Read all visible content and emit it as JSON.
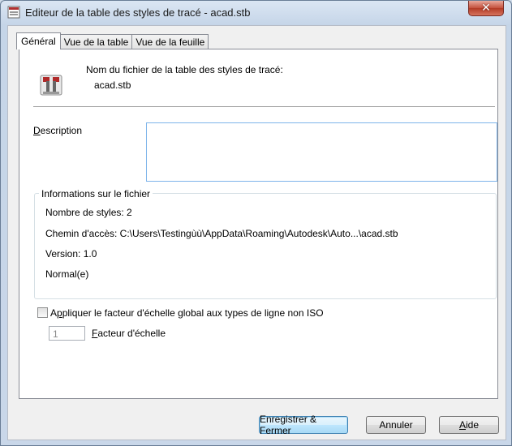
{
  "window": {
    "title": "Editeur de la table des styles de tracé - acad.stb",
    "close_glyph": "✕"
  },
  "tabs": [
    "Général",
    "Vue de la table",
    "Vue de la feuille"
  ],
  "file": {
    "label": "Nom du fichier de la table des styles de tracé:",
    "name": "acad.stb",
    "icon": "plot-style-table-icon"
  },
  "description": {
    "label_mnemonic": "D",
    "label_rest": "escription",
    "value": ""
  },
  "file_info": {
    "title": "Informations sur le fichier",
    "styles_count": "Nombre de styles: 2",
    "path": "Chemin d'accès: C:\\Users\\Testingùù\\AppData\\Roaming\\Autodesk\\Auto...\\acad.stb",
    "version": "Version: 1.0",
    "mode": "Normal(e)"
  },
  "scale_option": {
    "checkbox_pre": "A",
    "checkbox_mnemonic": "p",
    "checkbox_rest": "pliquer le facteur d'échelle global aux types de ligne non ISO",
    "checked": false,
    "factor_value": "1",
    "factor_mnemonic": "F",
    "factor_rest": "acteur d'échelle"
  },
  "buttons": {
    "save_close": "Enregistrer & Fermer",
    "cancel": "Annuler",
    "help_mnemonic": "A",
    "help_rest": "ide"
  }
}
